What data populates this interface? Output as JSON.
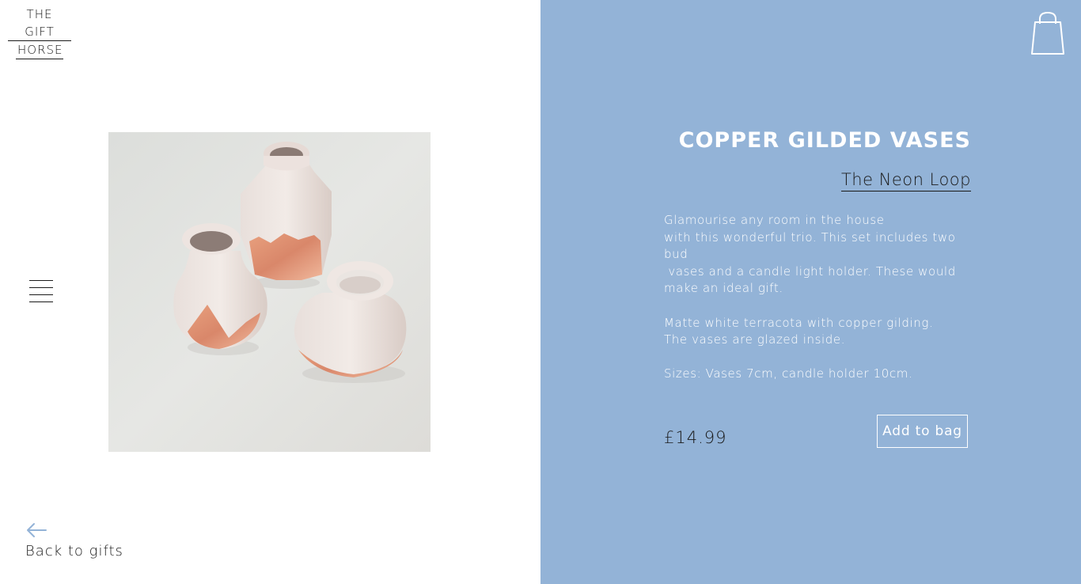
{
  "header": {
    "logo_line1": "THE GIFT",
    "logo_line2": "HORSE",
    "menu_icon": "hamburger-icon",
    "cart_icon": "shopping-bag-icon"
  },
  "product": {
    "title": "COPPER GILDED VASES",
    "brand": "The Neon Loop",
    "description": [
      [
        "Glamourise any room in the house",
        "with this wonderful trio. This set includes two bud",
        " vases and a candle light holder. These would",
        "make an ideal gift."
      ],
      [
        "Matte white terracota with copper gilding.",
        "The vases are glazed inside."
      ],
      [
        "Sizes: Vases 7cm, candle holder 10cm."
      ]
    ],
    "price": "£14.99",
    "add_to_bag_label": "Add to bag"
  },
  "navigation": {
    "back_label": "Back to gifts",
    "back_icon": "arrow-left-icon"
  },
  "colors": {
    "panel_background": "#93b3d7",
    "arrow_accent": "#93b3d7",
    "text_dark": "#1a1a1a",
    "text_light": "#ffffff"
  }
}
